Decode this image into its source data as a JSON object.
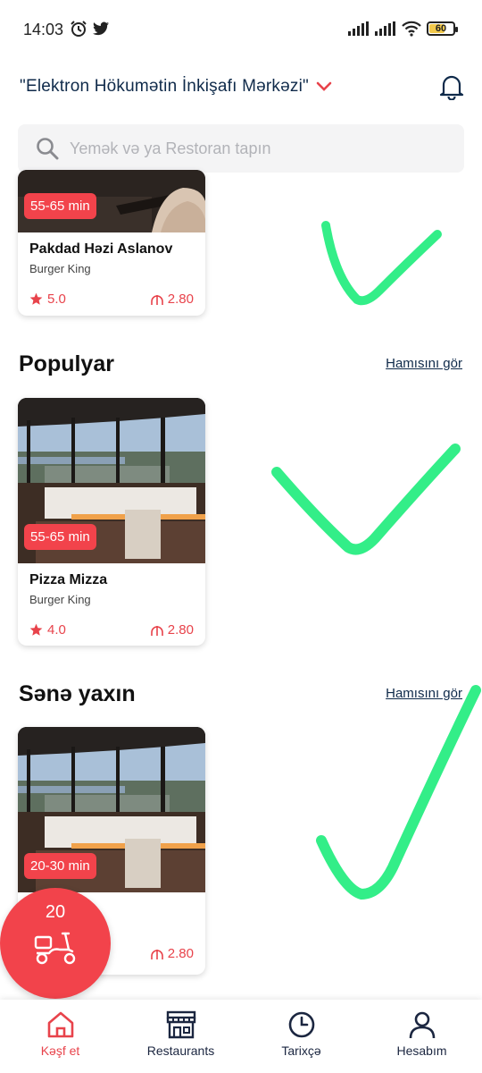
{
  "status_bar": {
    "time": "14:03",
    "battery": "60",
    "battery_fraction": 0.6
  },
  "header": {
    "location": "\"Elektron Hökumətin İnkişafı Mərkəzi\""
  },
  "search": {
    "placeholder": "Yemək və ya Restoran tapın"
  },
  "cards_top": {
    "badge": "55-65 min",
    "title": "Pakdad Həzi Aslanov",
    "subtitle": "Burger King",
    "rating": "5.0",
    "delivery": "2.80"
  },
  "popular": {
    "title": "Populyar",
    "see_all": "Hamısını gör",
    "card": {
      "badge": "55-65 min",
      "title": "Pizza Mizza",
      "subtitle": "Burger King",
      "rating": "4.0",
      "delivery": "2.80"
    }
  },
  "nearby": {
    "title": "Sənə yaxın",
    "see_all": "Hamısını gör",
    "card": {
      "badge": "20-30 min",
      "delivery": "2.80"
    }
  },
  "fab": {
    "count": "20"
  },
  "nav": {
    "items": [
      {
        "label": "Kəşf et"
      },
      {
        "label": "Restaurants"
      },
      {
        "label": "Tarixçə"
      },
      {
        "label": "Hesabım"
      }
    ]
  },
  "colors": {
    "accent": "#f2434b",
    "check": "#33ee88",
    "navy": "#0f2a4a"
  }
}
